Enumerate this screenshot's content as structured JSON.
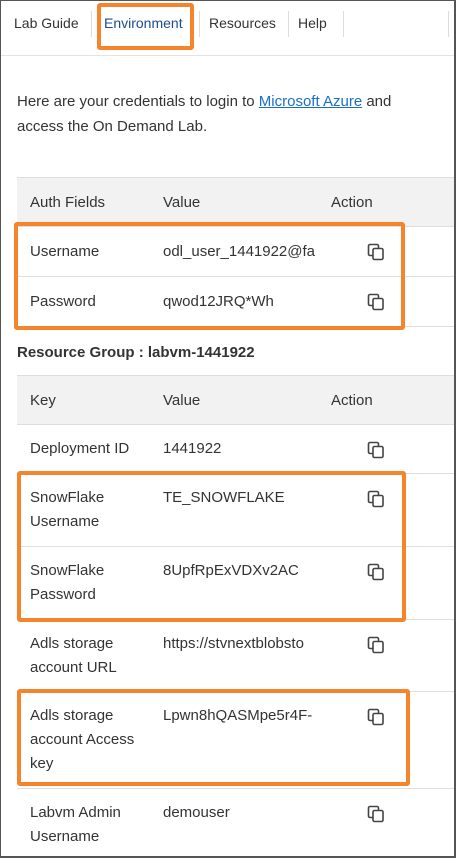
{
  "tabs": [
    {
      "label": "Lab Guide"
    },
    {
      "label": "Environment"
    },
    {
      "label": "Resources"
    },
    {
      "label": "Help"
    }
  ],
  "intro": {
    "text_before": "Here are your credentials to login to ",
    "link": "Microsoft Azure",
    "text_after": " and access the On Demand Lab."
  },
  "auth_table": {
    "headers": [
      "Auth Fields",
      "Value",
      "Action"
    ],
    "rows": [
      {
        "field": "Username",
        "value": "odl_user_1441922@fa"
      },
      {
        "field": "Password",
        "value": "qwod12JRQ*Wh"
      }
    ]
  },
  "resource_group": {
    "label": "Resource Group : labvm-1441922"
  },
  "resource_table": {
    "headers": [
      "Key",
      "Value",
      "Action"
    ],
    "rows": [
      {
        "key": "Deployment ID",
        "value": "1441922"
      },
      {
        "key": "SnowFlake Username",
        "value": "TE_SNOWFLAKE"
      },
      {
        "key": "SnowFlake Password",
        "value": "8UpfRpExVDXv2AC"
      },
      {
        "key": "Adls storage account URL",
        "value": "https://stvnextblobsto"
      },
      {
        "key": "Adls storage account Access key",
        "value": "Lpwn8hQASMpe5r4F-"
      },
      {
        "key": "Labvm Admin Username",
        "value": "demouser"
      }
    ]
  },
  "colors": {
    "highlight": "#f5842a",
    "link": "#1a6fc9",
    "active_tab": "#1a4d8f"
  },
  "icons": {
    "copy": "copy-icon"
  }
}
